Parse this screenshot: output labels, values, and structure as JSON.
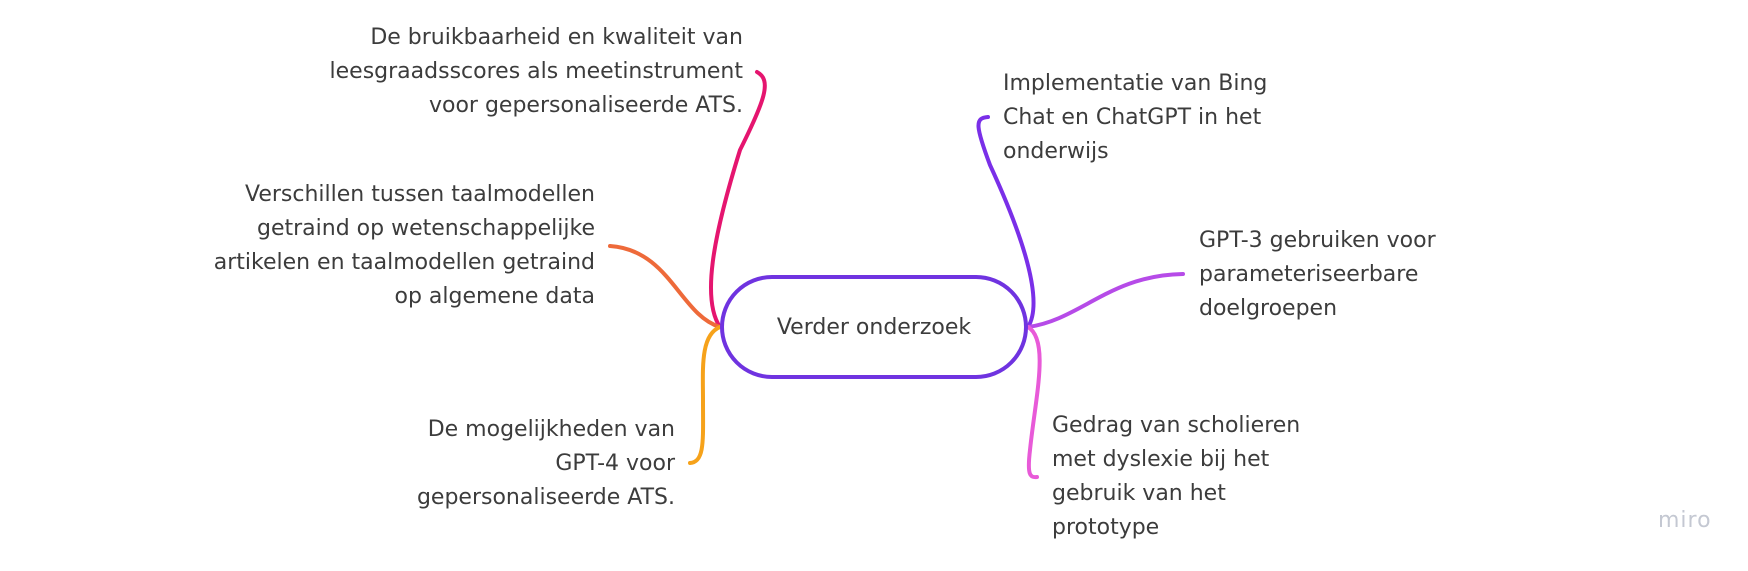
{
  "center": {
    "label": "Verder onderzoek",
    "color": "#6f33e0"
  },
  "branches": [
    {
      "id": "leesgraad",
      "side": "left",
      "color": "#e5156f",
      "lines": [
        "De bruikbaarheid en kwaliteit van",
        "leesgraadsscores als meetinstrument",
        "voor gepersonaliseerde ATS."
      ]
    },
    {
      "id": "taalmodellen",
      "side": "left",
      "color": "#ee6a3a",
      "lines": [
        "Verschillen tussen taalmodellen",
        "getraind op wetenschappelijke",
        "artikelen en taalmodellen getraind",
        "op algemene data"
      ]
    },
    {
      "id": "gpt4",
      "side": "left",
      "color": "#f6a21a",
      "lines": [
        "De mogelijkheden van",
        "GPT-4 voor",
        "gepersonaliseerde ATS."
      ]
    },
    {
      "id": "bing-chat",
      "side": "right",
      "color": "#7a2fe8",
      "lines": [
        "Implementatie van Bing",
        "Chat en ChatGPT in het",
        "onderwijs"
      ]
    },
    {
      "id": "gpt3",
      "side": "right",
      "color": "#b64be8",
      "lines": [
        "GPT-3 gebruiken voor",
        "parameteriseerbare",
        "doelgroepen"
      ]
    },
    {
      "id": "dyslexie",
      "side": "right",
      "color": "#e85ad8",
      "lines": [
        "Gedrag van scholieren",
        "met dyslexie bij het",
        "gebruik van het",
        "prototype"
      ]
    }
  ],
  "watermark": "miro"
}
